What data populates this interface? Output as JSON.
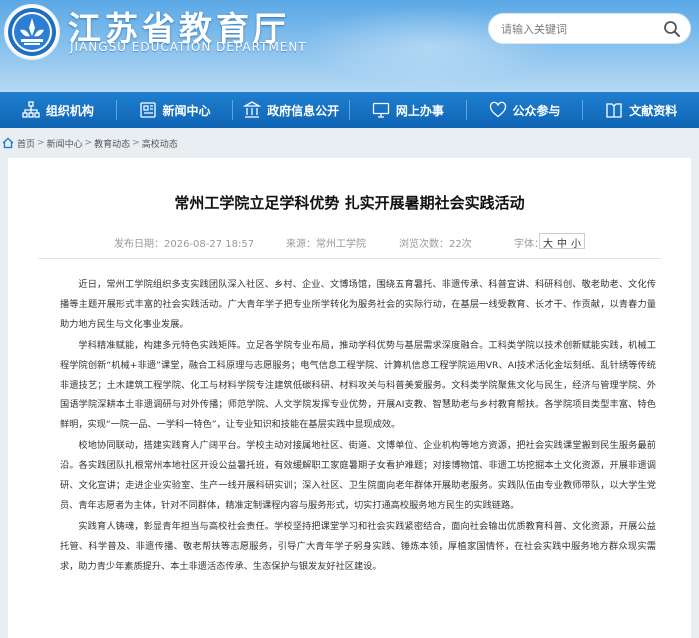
{
  "header": {
    "site_title": "江苏省教育厅",
    "site_subtitle": "JIANGSU EDUCATION DEPARTMENT",
    "search_placeholder": "请输入关键词",
    "brand_color": "#1a76c7",
    "icons": {
      "emblem": "education-emblem-icon",
      "search": "search-icon"
    }
  },
  "nav": {
    "items": [
      {
        "label": "组织机构",
        "icon": "org-structure-icon"
      },
      {
        "label": "新闻中心",
        "icon": "news-icon"
      },
      {
        "label": "政府信息公开",
        "icon": "government-info-icon"
      },
      {
        "label": "网上办事",
        "icon": "online-service-icon"
      },
      {
        "label": "公众参与",
        "icon": "public-participation-icon"
      },
      {
        "label": "文献资料",
        "icon": "documents-icon"
      }
    ]
  },
  "breadcrumb": [
    "首页",
    "新闻中心",
    "教育动态",
    "高校动态"
  ],
  "article": {
    "title": "常州工学院立足学科优势 扎实开展暑期社会实践活动",
    "date_label": "发布日期：2026-08-27 18:57",
    "source_label": "来源：常州工学院",
    "views_label": "浏览次数：22次",
    "font_label": "字体：",
    "font_sizes": [
      "大",
      "中",
      "小"
    ],
    "paragraphs": [
      "近日，常州工学院组织多支实践团队深入社区、乡村、企业、文博场馆，围绕五育暑托、非遗传承、科普宣讲、科研科创、敬老助老、文化传播等主题开展形式丰富的社会实践活动。广大青年学子把专业所学转化为服务社会的实际行动，在基层一线受教育、长才干、作贡献，以青春力量助力地方民生与文化事业发展。",
      "学科精准赋能，构建多元特色实践矩阵。立足各学院专业布局，推动学科优势与基层需求深度融合。工科类学院以技术创新赋能实践，机械工程学院创新“机械+非遗”课堂，融合工科原理与志愿服务；电气信息工程学院、计算机信息工程学院运用VR、AI技术活化金坛刻纸、乱针绣等传统非遗技艺；土木建筑工程学院、化工与材料学院专注建筑低碳科研、材料攻关与科普美爱服务。文科类学院聚焦文化与民生，经济与管理学院、外国语学院深耕本土非遗调研与对外传播；师范学院、人文学院发挥专业优势，开展AI支教、智慧助老与乡村教育帮扶。各学院项目类型丰富、特色鲜明，实现“一院一品、一学科一特色”，让专业知识和技能在基层实践中显现成效。",
      "校地协同联动，搭建实践育人广阔平台。学校主动对接属地社区、街道、文博单位、企业机构等地方资源，把社会实践课堂搬到民生服务最前沿。各实践团队扎根常州本地社区开设公益暑托班，有效缓解职工家庭暑期子女看护难题；对接博物馆、非遗工坊挖掘本土文化资源，开展非遗调研、文化宣讲；走进企业实验室、生产一线开展科研实训；深入社区、卫生院面向老年群体开展助老服务。实践队伍由专业教师带队，以大学生党员、青年志愿者为主体，针对不同群体，精准定制课程内容与服务形式，切实打通高校服务地方民生的实践链路。",
      "实践育人铸魂，彰显青年担当与高校社会责任。学校坚持把课堂学习和社会实践紧密结合，面向社会输出优质教育科普、文化资源，开展公益托管、科学普及、非遗传播、敬老帮扶等志愿服务，引导广大青年学子躬身实践、锤炼本领，厚植家国情怀，在社会实践中服务地方群众现实需求，助力青少年素质提升、本土非遗活态传承、生态保护与银发友好社区建设。"
    ]
  }
}
